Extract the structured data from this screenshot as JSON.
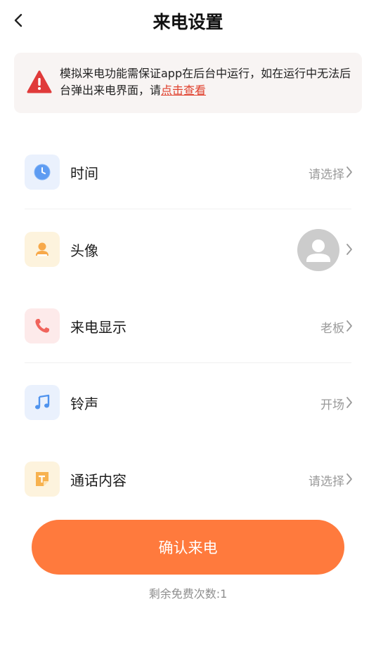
{
  "header": {
    "title": "来电设置"
  },
  "notice": {
    "text": "模拟来电功能需保证app在后台中运行，如在运行中无法后台弹出来电界面，请",
    "link": "点击查看"
  },
  "rows": [
    {
      "label": "时间",
      "value": "请选择"
    },
    {
      "label": "头像",
      "value": ""
    },
    {
      "label": "来电显示",
      "value": "老板"
    },
    {
      "label": "铃声",
      "value": "开场"
    },
    {
      "label": "通话内容",
      "value": "请选择"
    }
  ],
  "confirm_label": "确认来电",
  "remaining_text": "剩余免费次数:1",
  "colors": {
    "accent": "#ff7a3d",
    "warning": "#e03a3a",
    "link": "#e0402d"
  }
}
